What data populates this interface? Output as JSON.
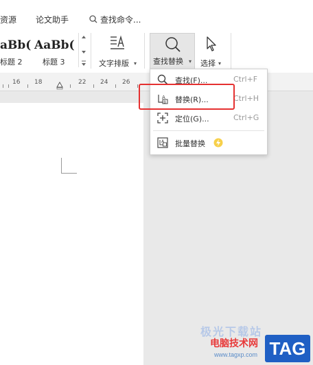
{
  "tabs": {
    "resources": "资源",
    "thesis_assistant": "论文助手",
    "search_commands": "查找命令..."
  },
  "styles": [
    {
      "preview": "aBb(",
      "name": "标题 2"
    },
    {
      "preview": "AaBb(",
      "name": "标题 3"
    }
  ],
  "ribbon": {
    "text_layout": "文字排版",
    "find_replace": "查找替换",
    "select": "选择"
  },
  "ruler": [
    "16",
    "18",
    "22",
    "24",
    "26"
  ],
  "menu": {
    "items": [
      {
        "label": "查找(F)...",
        "shortcut": "Ctrl+F",
        "icon": "search-icon"
      },
      {
        "label": "替换(R)...",
        "shortcut": "Ctrl+H",
        "icon": "replace-icon"
      },
      {
        "label": "定位(G)...",
        "shortcut": "Ctrl+G",
        "icon": "locate-icon"
      },
      {
        "label": "批量替换",
        "icon": "batch-replace-icon",
        "badge": "vip-lightning-icon"
      }
    ],
    "highlight_color": "#e53030"
  },
  "watermark": {
    "arc_text": "极光下载站",
    "site_name": "电脑技术网",
    "url": "www.tagxp.com",
    "tag": "TAG"
  }
}
